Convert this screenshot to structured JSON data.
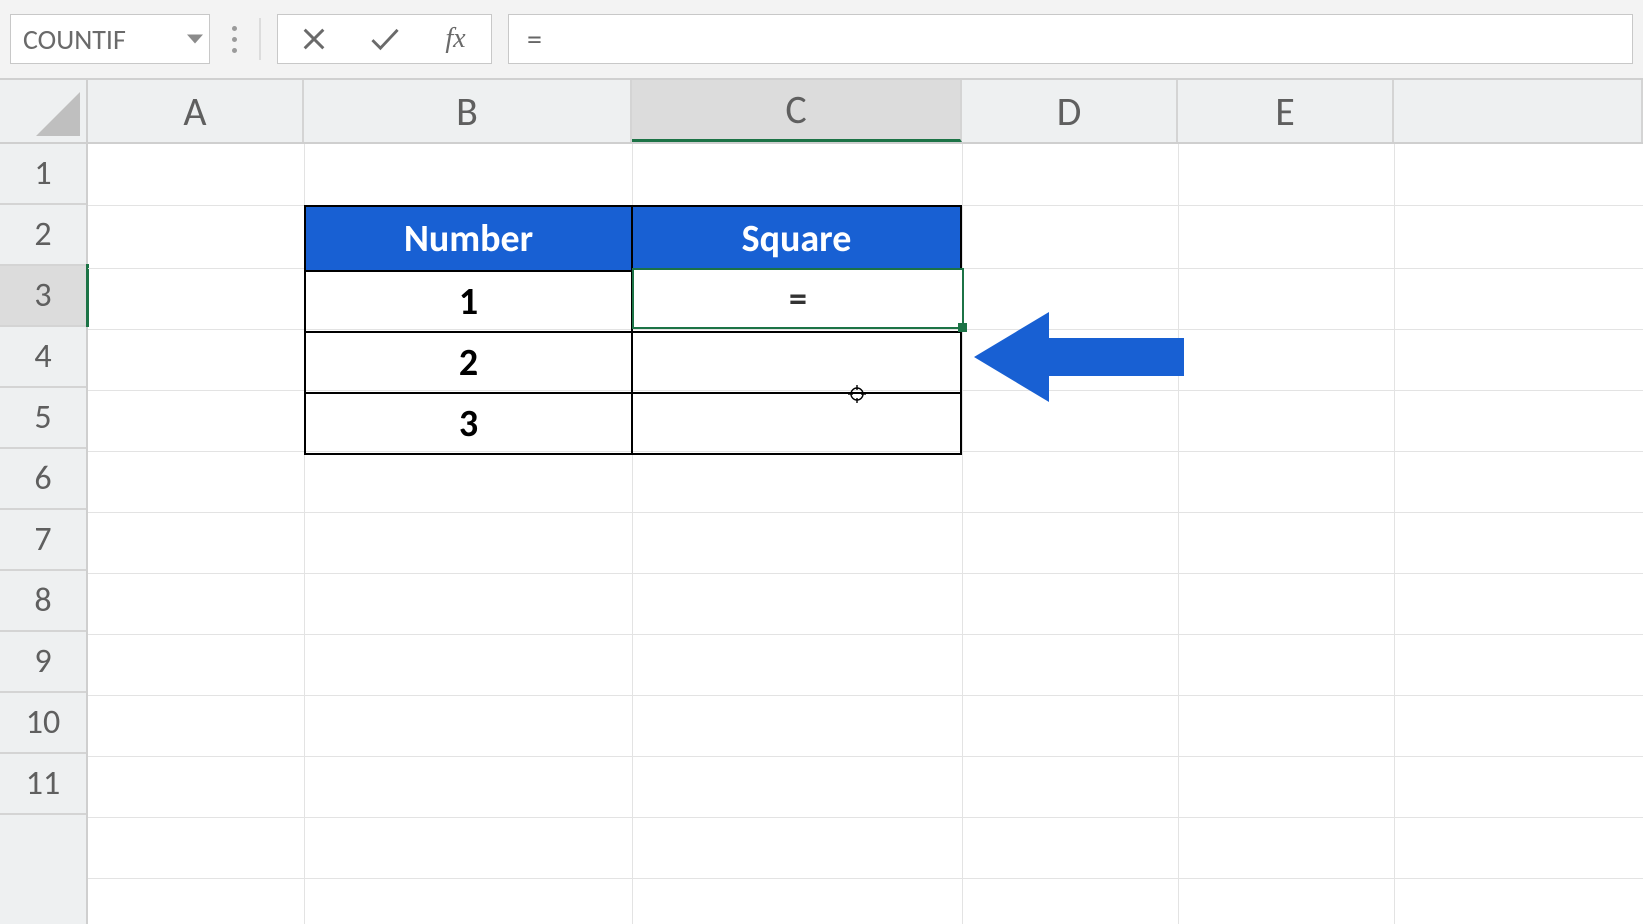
{
  "formula_bar": {
    "name_box_value": "COUNTIF",
    "fx_label": "fx",
    "formula_value": "="
  },
  "columns": [
    "A",
    "B",
    "C",
    "D",
    "E"
  ],
  "active_column": "C",
  "rows": [
    "1",
    "2",
    "3",
    "4",
    "5",
    "6",
    "7",
    "8",
    "9",
    "10",
    "11"
  ],
  "active_row": "3",
  "table": {
    "headers": {
      "col1": "Number",
      "col2": "Square"
    },
    "rows": [
      {
        "number": "1",
        "square": "="
      },
      {
        "number": "2",
        "square": ""
      },
      {
        "number": "3",
        "square": ""
      }
    ]
  },
  "active_cell_value": "=",
  "annotation": {
    "arrow_color": "#1860d3"
  }
}
